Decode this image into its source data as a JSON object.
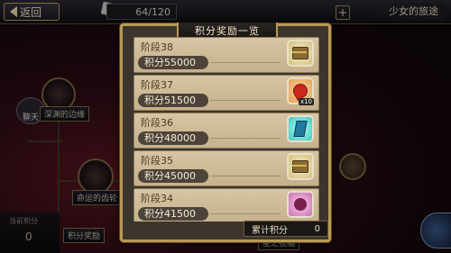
{
  "topbar": {
    "back_label": "返回",
    "stamina": "64/120",
    "plus": "+",
    "screen_title": "少女的旅途"
  },
  "map": {
    "chat_label": "聊天",
    "left_panel_label": "当前积分",
    "left_panel_value": "0",
    "node_labels": [
      "深渊的边缘",
      "命运的齿轮",
      "积分奖励",
      "星之祝福"
    ]
  },
  "modal": {
    "title": "积分奖励一览",
    "rewards": [
      {
        "stage": "阶段38",
        "points": "积分55000",
        "icon": "treasure-chest-icon"
      },
      {
        "stage": "阶段37",
        "points": "积分51500",
        "icon": "red-gem-icon",
        "count": "x10"
      },
      {
        "stage": "阶段36",
        "points": "积分48000",
        "icon": "crystal-icon"
      },
      {
        "stage": "阶段35",
        "points": "积分45000",
        "icon": "treasure-chest-icon"
      },
      {
        "stage": "阶段34",
        "points": "积分41500",
        "icon": "pink-item-icon"
      }
    ],
    "total_label": "累计积分",
    "total_value": "0"
  }
}
